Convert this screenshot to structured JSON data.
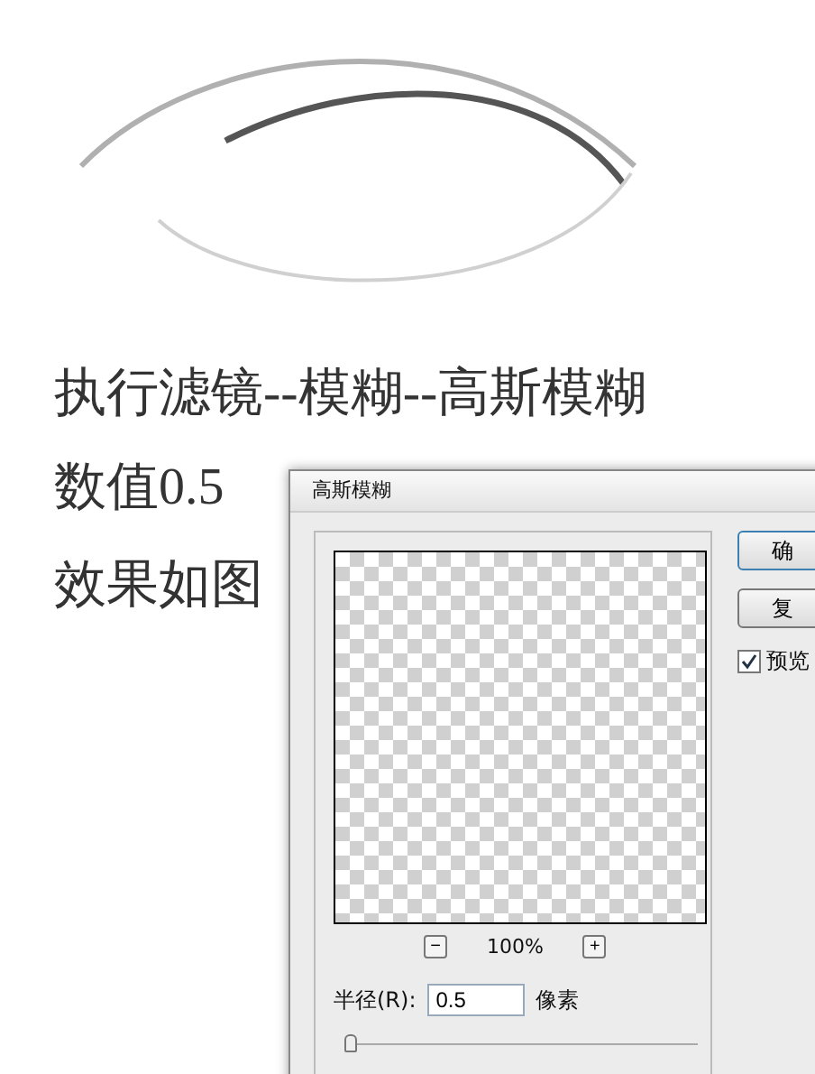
{
  "steps": [
    "执行滤镜--模糊--高斯模糊",
    "数值0.5",
    "效果如图"
  ],
  "dialog": {
    "title": "高斯模糊",
    "buttons": [
      "确",
      "复"
    ],
    "preview": {
      "label": "预览",
      "checked": true
    },
    "zoom": {
      "minus": "−",
      "value": "100%",
      "plus": "+"
    },
    "radius": {
      "label": "半径(R):",
      "value": "0.5",
      "unit": "像素",
      "level": 0
    }
  }
}
